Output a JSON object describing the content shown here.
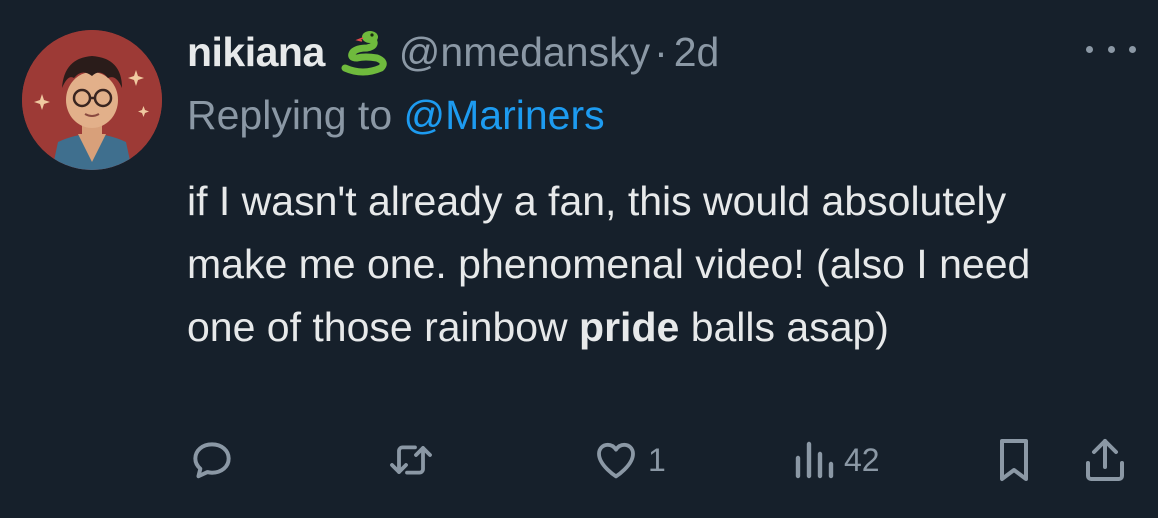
{
  "tweet": {
    "display_name": "nikiana",
    "name_emoji": "snake-emoji",
    "handle": "@nmedansky",
    "separator": "·",
    "time": "2d",
    "replying_to_prefix": "Replying to ",
    "replying_to_handle": "@Mariners",
    "text_part1": "if I wasn't already a fan, this would absolutely make me one. phenomenal video! (also I need one of those rainbow ",
    "text_bold": "pride",
    "text_part2": " balls asap)"
  },
  "actions": {
    "reply_icon": "reply-icon",
    "retweet_icon": "retweet-icon",
    "like_icon": "heart-icon",
    "like_count": "1",
    "views_icon": "views-icon",
    "views_count": "42",
    "bookmark_icon": "bookmark-icon",
    "share_icon": "share-icon"
  },
  "colors": {
    "background": "#16202b",
    "text": "#e7e9ea",
    "muted": "#8b98a5",
    "link": "#1d9bf0"
  }
}
